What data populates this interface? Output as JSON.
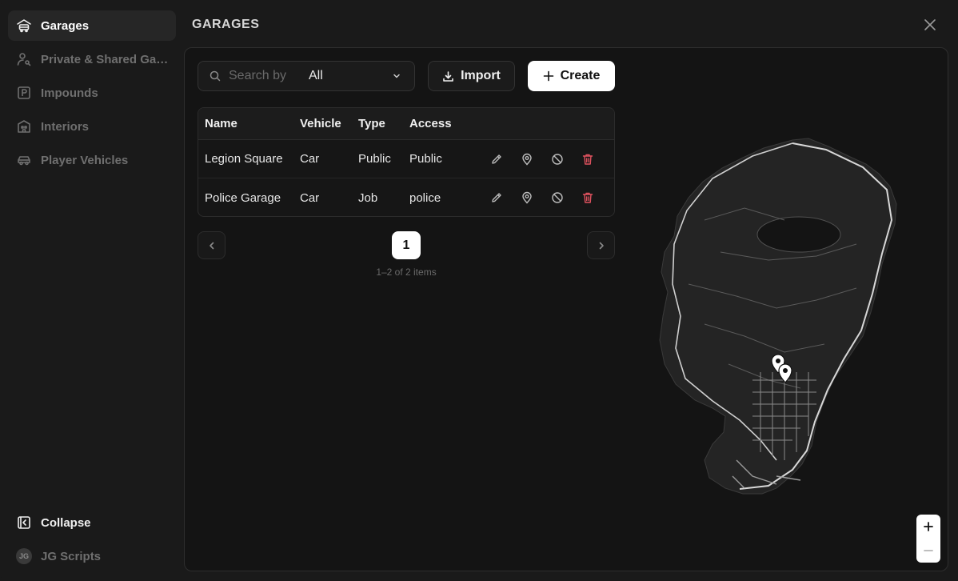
{
  "sidebar": {
    "items": [
      {
        "label": "Garages",
        "icon": "garage-icon"
      },
      {
        "label": "Private & Shared Garages",
        "icon": "user-key-icon"
      },
      {
        "label": "Impounds",
        "icon": "parking-icon"
      },
      {
        "label": "Interiors",
        "icon": "building-icon"
      },
      {
        "label": "Player Vehicles",
        "icon": "car-icon"
      }
    ],
    "collapse_label": "Collapse",
    "user_initials": "JG",
    "user_name": "JG Scripts"
  },
  "header": {
    "title": "GARAGES"
  },
  "toolbar": {
    "search_placeholder": "Search by",
    "filter_value": "All",
    "import_label": "Import",
    "create_label": "Create"
  },
  "table": {
    "columns": [
      "Name",
      "Vehicle",
      "Type",
      "Access"
    ],
    "rows": [
      {
        "name": "Legion Square",
        "vehicle": "Car",
        "type": "Public",
        "access": "Public"
      },
      {
        "name": "Police Garage",
        "vehicle": "Car",
        "type": "Job",
        "access": "police"
      }
    ]
  },
  "pagination": {
    "current_page": "1",
    "info": "1–2 of 2 items"
  },
  "map": {
    "zoom_in": "+",
    "zoom_out": "−"
  },
  "colors": {
    "background": "#1a1a1a",
    "panel": "#141414",
    "accent_white": "#ffffff",
    "delete_red": "#e0525f"
  }
}
